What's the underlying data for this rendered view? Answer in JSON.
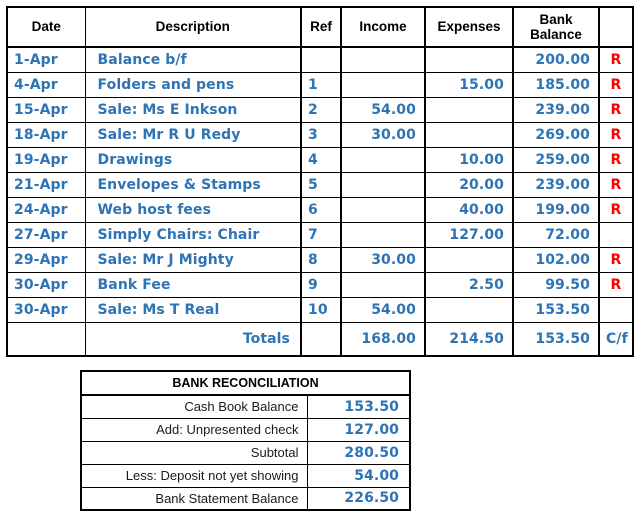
{
  "cashbook": {
    "columns": [
      {
        "key": "date",
        "label": "Date"
      },
      {
        "key": "description",
        "label": "Description"
      },
      {
        "key": "ref",
        "label": "Ref"
      },
      {
        "key": "income",
        "label": "Income"
      },
      {
        "key": "expenses",
        "label": "Expenses"
      },
      {
        "key": "bank_balance",
        "label": "Bank\nBalance"
      },
      {
        "key": "reconciled",
        "label": ""
      }
    ],
    "header_bank_balance_line1": "Bank",
    "header_bank_balance_line2": "Balance",
    "rows": [
      {
        "date": "1-Apr",
        "description": "Balance b/f",
        "ref": "",
        "income": "",
        "expenses": "",
        "bank_balance": "200.00",
        "reconciled": "R"
      },
      {
        "date": "4-Apr",
        "description": "Folders and pens",
        "ref": "1",
        "income": "",
        "expenses": "15.00",
        "bank_balance": "185.00",
        "reconciled": "R"
      },
      {
        "date": "15-Apr",
        "description": "Sale: Ms E Inkson",
        "ref": "2",
        "income": "54.00",
        "expenses": "",
        "bank_balance": "239.00",
        "reconciled": "R"
      },
      {
        "date": "18-Apr",
        "description": "Sale: Mr R U Redy",
        "ref": "3",
        "income": "30.00",
        "expenses": "",
        "bank_balance": "269.00",
        "reconciled": "R"
      },
      {
        "date": "19-Apr",
        "description": "Drawings",
        "ref": "4",
        "income": "",
        "expenses": "10.00",
        "bank_balance": "259.00",
        "reconciled": "R"
      },
      {
        "date": "21-Apr",
        "description": "Envelopes & Stamps",
        "ref": "5",
        "income": "",
        "expenses": "20.00",
        "bank_balance": "239.00",
        "reconciled": "R"
      },
      {
        "date": "24-Apr",
        "description": "Web host fees",
        "ref": "6",
        "income": "",
        "expenses": "40.00",
        "bank_balance": "199.00",
        "reconciled": "R"
      },
      {
        "date": "27-Apr",
        "description": "Simply Chairs: Chair",
        "ref": "7",
        "income": "",
        "expenses": "127.00",
        "bank_balance": "72.00",
        "reconciled": ""
      },
      {
        "date": "29-Apr",
        "description": "Sale: Mr J Mighty",
        "ref": "8",
        "income": "30.00",
        "expenses": "",
        "bank_balance": "102.00",
        "reconciled": "R"
      },
      {
        "date": "30-Apr",
        "description": "Bank Fee",
        "ref": "9",
        "income": "",
        "expenses": "2.50",
        "bank_balance": "99.50",
        "reconciled": "R"
      },
      {
        "date": "30-Apr",
        "description": "Sale: Ms T Real",
        "ref": "10",
        "income": "54.00",
        "expenses": "",
        "bank_balance": "153.50",
        "reconciled": ""
      }
    ],
    "totals": {
      "label": "Totals",
      "date": "",
      "ref": "",
      "income": "168.00",
      "expenses": "214.50",
      "bank_balance": "153.50",
      "reconciled": "C/f"
    }
  },
  "reconciliation": {
    "title": "BANK RECONCILIATION",
    "rows": [
      {
        "label": "Cash Book Balance",
        "value": "153.50"
      },
      {
        "label": "Add: Unpresented check",
        "value": "127.00"
      },
      {
        "label": "Subtotal",
        "value": "280.50"
      },
      {
        "label": "Less: Deposit not yet showing",
        "value": "54.00"
      },
      {
        "label": "Bank Statement Balance",
        "value": "226.50"
      }
    ]
  },
  "colors": {
    "handwriting_blue": "#2E74B5",
    "reconciled_red": "#FF0000",
    "border_black": "#000000",
    "page_background": "#FFFFFF"
  }
}
